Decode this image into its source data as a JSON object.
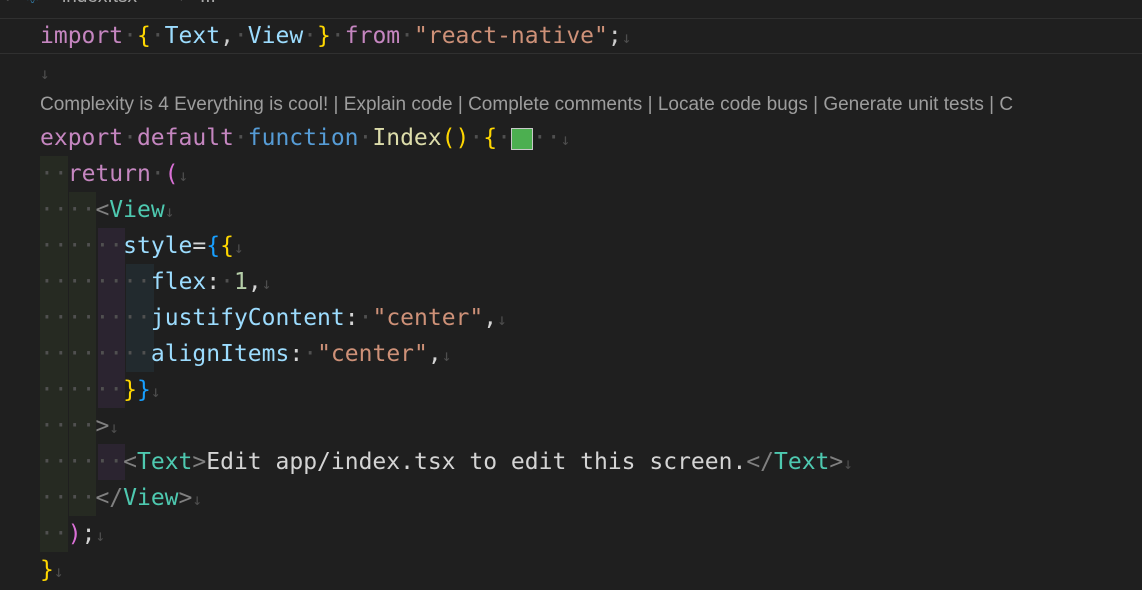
{
  "breadcrumb": {
    "icon": "react-icon",
    "file": "index.tsx",
    "separator": ">",
    "more": "..."
  },
  "code_lens": {
    "complexity": "Complexity is 4 Everything is cool!",
    "sep": " | ",
    "actions": [
      "Explain code",
      "Complete comments",
      "Locate code bugs",
      "Generate unit tests",
      "C"
    ]
  },
  "colors": {
    "editor_bg": "#1f1f1f",
    "swatch": "#4caf50"
  },
  "code": {
    "l1": {
      "import": "import",
      "space": " ",
      "ob": "{",
      "text": "Text",
      "comma": ",",
      "view": "View",
      "cb": "}",
      "from": "from",
      "mod": "\"react-native\"",
      "semi": ";"
    },
    "l3": {
      "export": "export",
      "default": "default",
      "function": "function",
      "name": "Index",
      "parens": "()",
      "brace": "{"
    },
    "l4": {
      "return": "return",
      "paren": "("
    },
    "l5": {
      "lt": "<",
      "tag": "View"
    },
    "l6": {
      "attr": "style",
      "eq": "=",
      "b1": "{",
      "b2": "{"
    },
    "l7": {
      "key": "flex",
      "colon": ":",
      "val": "1",
      "comma": ","
    },
    "l8": {
      "key": "justifyContent",
      "colon": ":",
      "val": "\"center\"",
      "comma": ","
    },
    "l9": {
      "key": "alignItems",
      "colon": ":",
      "val": "\"center\"",
      "comma": ","
    },
    "l10": {
      "b1": "}",
      "b2": "}"
    },
    "l11": {
      "gt": ">"
    },
    "l12": {
      "lt": "<",
      "tag": "Text",
      "gt": ">",
      "content": "Edit app/index.tsx to edit this screen.",
      "clt": "</",
      "ctag": "Text",
      "cgt": ">"
    },
    "l13": {
      "clt": "</",
      "tag": "View",
      "gt": ">"
    },
    "l14": {
      "paren": ")",
      "semi": ";"
    },
    "l15": {
      "brace": "}"
    }
  },
  "glyphs": {
    "ret": "↓",
    "dot": "·"
  }
}
